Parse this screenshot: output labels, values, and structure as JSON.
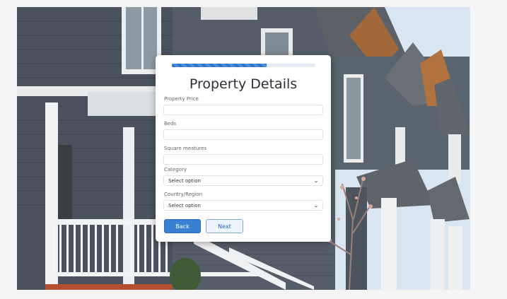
{
  "hero": {
    "description_icon": "house-row-photo"
  },
  "form": {
    "progress": 0.66,
    "title": "Property Details",
    "fields": {
      "price": {
        "label": "Property Price",
        "value": ""
      },
      "beds": {
        "label": "Beds",
        "value": ""
      },
      "square": {
        "label": "Square meatures",
        "value": ""
      },
      "category": {
        "label": "Category",
        "selected": "Select option"
      },
      "country": {
        "label": "Country/Region",
        "selected": "Select option"
      }
    },
    "buttons": {
      "back": "Back",
      "next": "Next"
    }
  },
  "colors": {
    "accent": "#3a80d2",
    "next_border": "#7ea9dc"
  }
}
